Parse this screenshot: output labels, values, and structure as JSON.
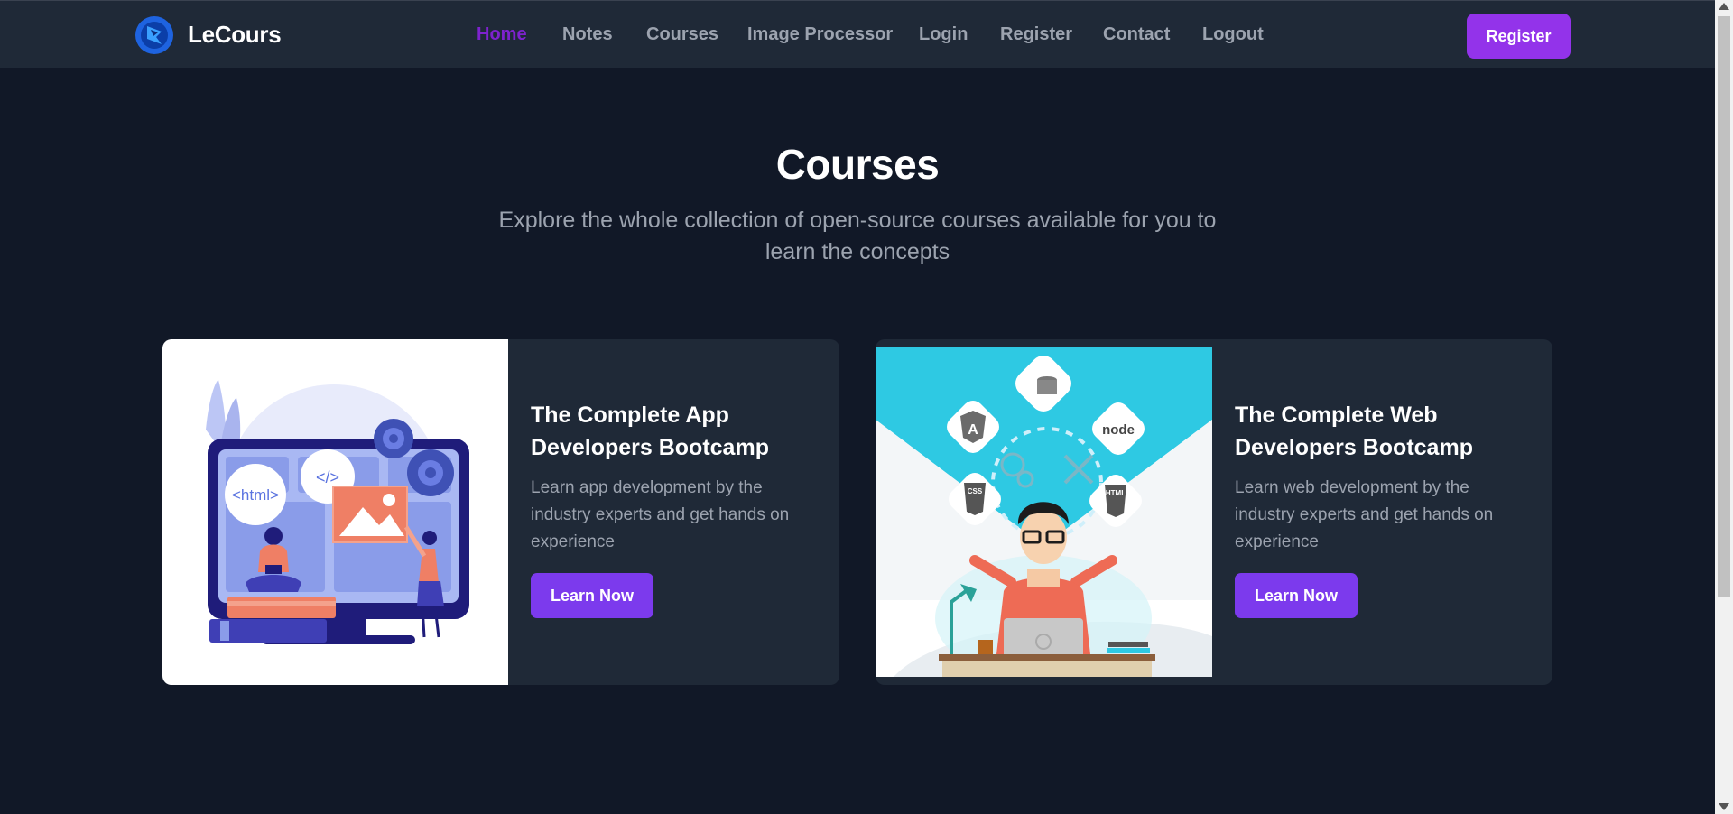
{
  "header": {
    "brand": "LeCours",
    "nav": [
      {
        "label": "Home",
        "active": true
      },
      {
        "label": "Notes"
      },
      {
        "label": "Courses"
      },
      {
        "label": "Image Processor"
      },
      {
        "label": "Login"
      },
      {
        "label": "Register"
      },
      {
        "label": "Contact"
      },
      {
        "label": "Logout"
      }
    ],
    "register_button": "Register"
  },
  "hero": {
    "title": "Courses",
    "subtitle": "Explore the whole collection of open-source courses available for you to learn the concepts"
  },
  "courses": [
    {
      "title": "The Complete App Developers Bootcamp",
      "description": "Learn app development by the industry experts and get hands on experience",
      "button": "Learn Now",
      "illustration_text": [
        "<html>",
        "</>"
      ]
    },
    {
      "title": "The Complete Web Developers Bootcamp",
      "description": "Learn web development by the industry experts and get hands on experience",
      "button": "Learn Now",
      "illustration_text": [
        "node",
        "CSS",
        "HTML"
      ]
    }
  ],
  "colors": {
    "background": "#111827",
    "header": "#1f2937",
    "card": "#1f2937",
    "accent": "#9333ea",
    "active_nav": "#7e22ce",
    "muted_text": "#9ca3af"
  },
  "icons": [
    "logo-icon",
    "scroll-up-icon",
    "scroll-down-icon"
  ]
}
